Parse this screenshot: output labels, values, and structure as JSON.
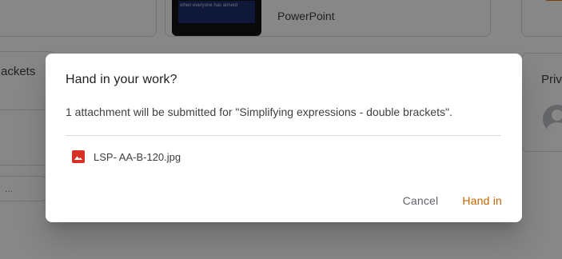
{
  "background": {
    "ppt_thumbnail_caption": "when everyone has arrived",
    "ppt_file_type": "PowerPoint",
    "left_card_partial_label": "ackets",
    "left_input_partial_placeholder": "...",
    "right_card_partial_label": "Priv"
  },
  "dialog": {
    "title": "Hand in your work?",
    "message": "1 attachment will be submitted for \"Simplifying expressions - double brackets\".",
    "attachment": {
      "name": "LSP- AA-B-120.jpg",
      "icon": "image-file-icon"
    },
    "actions": {
      "cancel_label": "Cancel",
      "hand_in_label": "Hand in"
    }
  },
  "colors": {
    "hand_in_accent": "#c26401",
    "attachment_icon": "#d93025",
    "scrim": "rgba(0,0,0,0.47)"
  }
}
